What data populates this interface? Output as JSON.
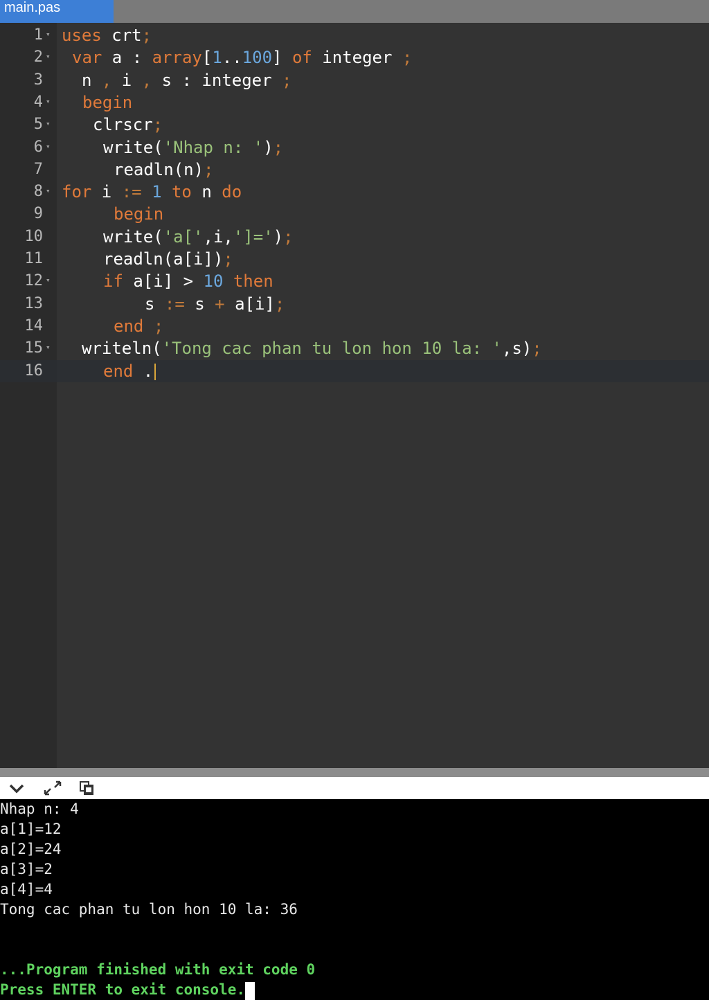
{
  "tab": {
    "filename": "main.pas"
  },
  "editor": {
    "lines": [
      {
        "n": "1",
        "tokens": [
          [
            "kw",
            "uses"
          ],
          [
            "t",
            " crt"
          ],
          [
            "pun",
            ";"
          ]
        ]
      },
      {
        "n": "2",
        "tokens": [
          [
            "kw",
            "var"
          ],
          [
            "t",
            " a : "
          ],
          [
            "kw",
            "array"
          ],
          [
            "t",
            "["
          ],
          [
            "num",
            "1"
          ],
          [
            "t",
            ".."
          ],
          [
            "num",
            "100"
          ],
          [
            "t",
            "] "
          ],
          [
            "kw",
            "of"
          ],
          [
            "t",
            " integer "
          ],
          [
            "pun",
            ";"
          ]
        ]
      },
      {
        "n": "3",
        "tokens": [
          [
            "t",
            "n "
          ],
          [
            "pun",
            ","
          ],
          [
            "t",
            " i "
          ],
          [
            "pun",
            ","
          ],
          [
            "t",
            " s : integer "
          ],
          [
            "pun",
            ";"
          ]
        ]
      },
      {
        "n": "4",
        "tokens": [
          [
            "kw",
            "begin"
          ]
        ]
      },
      {
        "n": "5",
        "tokens": [
          [
            "t",
            "clrscr"
          ],
          [
            "pun",
            ";"
          ]
        ]
      },
      {
        "n": "6",
        "tokens": [
          [
            "t",
            "write("
          ],
          [
            "str",
            "'Nhap n: '"
          ],
          [
            "t",
            ")"
          ],
          [
            "pun",
            ";"
          ]
        ]
      },
      {
        "n": "7",
        "tokens": [
          [
            "t",
            "readln(n)"
          ],
          [
            "pun",
            ";"
          ]
        ]
      },
      {
        "n": "8",
        "tokens": [
          [
            "kw",
            "for"
          ],
          [
            "t",
            " i "
          ],
          [
            "pun",
            ":="
          ],
          [
            "t",
            " "
          ],
          [
            "num",
            "1"
          ],
          [
            "t",
            " "
          ],
          [
            "kw",
            "to"
          ],
          [
            "t",
            " n "
          ],
          [
            "kw",
            "do"
          ]
        ]
      },
      {
        "n": "9",
        "tokens": [
          [
            "kw",
            "begin"
          ]
        ]
      },
      {
        "n": "10",
        "tokens": [
          [
            "t",
            "write("
          ],
          [
            "str",
            "'a['"
          ],
          [
            "t",
            ",i,"
          ],
          [
            "str",
            "']='"
          ],
          [
            "t",
            ")"
          ],
          [
            "pun",
            ";"
          ]
        ]
      },
      {
        "n": "11",
        "tokens": [
          [
            "t",
            "readln(a[i])"
          ],
          [
            "pun",
            ";"
          ]
        ]
      },
      {
        "n": "12",
        "tokens": [
          [
            "kw",
            "if"
          ],
          [
            "t",
            " a[i] > "
          ],
          [
            "num",
            "10"
          ],
          [
            "t",
            " "
          ],
          [
            "kw",
            "then"
          ]
        ]
      },
      {
        "n": "13",
        "tokens": [
          [
            "t",
            "s "
          ],
          [
            "pun",
            ":="
          ],
          [
            "t",
            " s "
          ],
          [
            "pun",
            "+"
          ],
          [
            "t",
            " a[i]"
          ],
          [
            "pun",
            ";"
          ]
        ]
      },
      {
        "n": "14",
        "tokens": [
          [
            "kw",
            "end"
          ],
          [
            "t",
            " "
          ],
          [
            "pun",
            ";"
          ]
        ]
      },
      {
        "n": "15",
        "tokens": [
          [
            "t",
            "writeln("
          ],
          [
            "str",
            "'Tong cac phan tu lon hon 10 la: '"
          ],
          [
            "t",
            ",s)"
          ],
          [
            "pun",
            ";"
          ]
        ]
      },
      {
        "n": "16",
        "tokens": [
          [
            "kw",
            "end"
          ],
          [
            "t",
            " ."
          ]
        ]
      }
    ]
  },
  "console": {
    "lines": [
      "Nhap n: 4",
      "a[1]=12",
      "a[2]=24",
      "a[3]=2",
      "a[4]=4",
      "Tong cac phan tu lon hon 10 la: 36",
      "",
      "",
      "...Program finished with exit code 0",
      "Press ENTER to exit console."
    ]
  },
  "icons": {
    "collapse": "chevron-down-icon",
    "expand": "expand-icon",
    "copy": "copy-icon"
  },
  "colors": {
    "tab": "#3d7fd6",
    "keyword": "#e07a3a",
    "string": "#9ac27a",
    "number": "#6ba7dd",
    "console_green": "#5fd35f"
  }
}
